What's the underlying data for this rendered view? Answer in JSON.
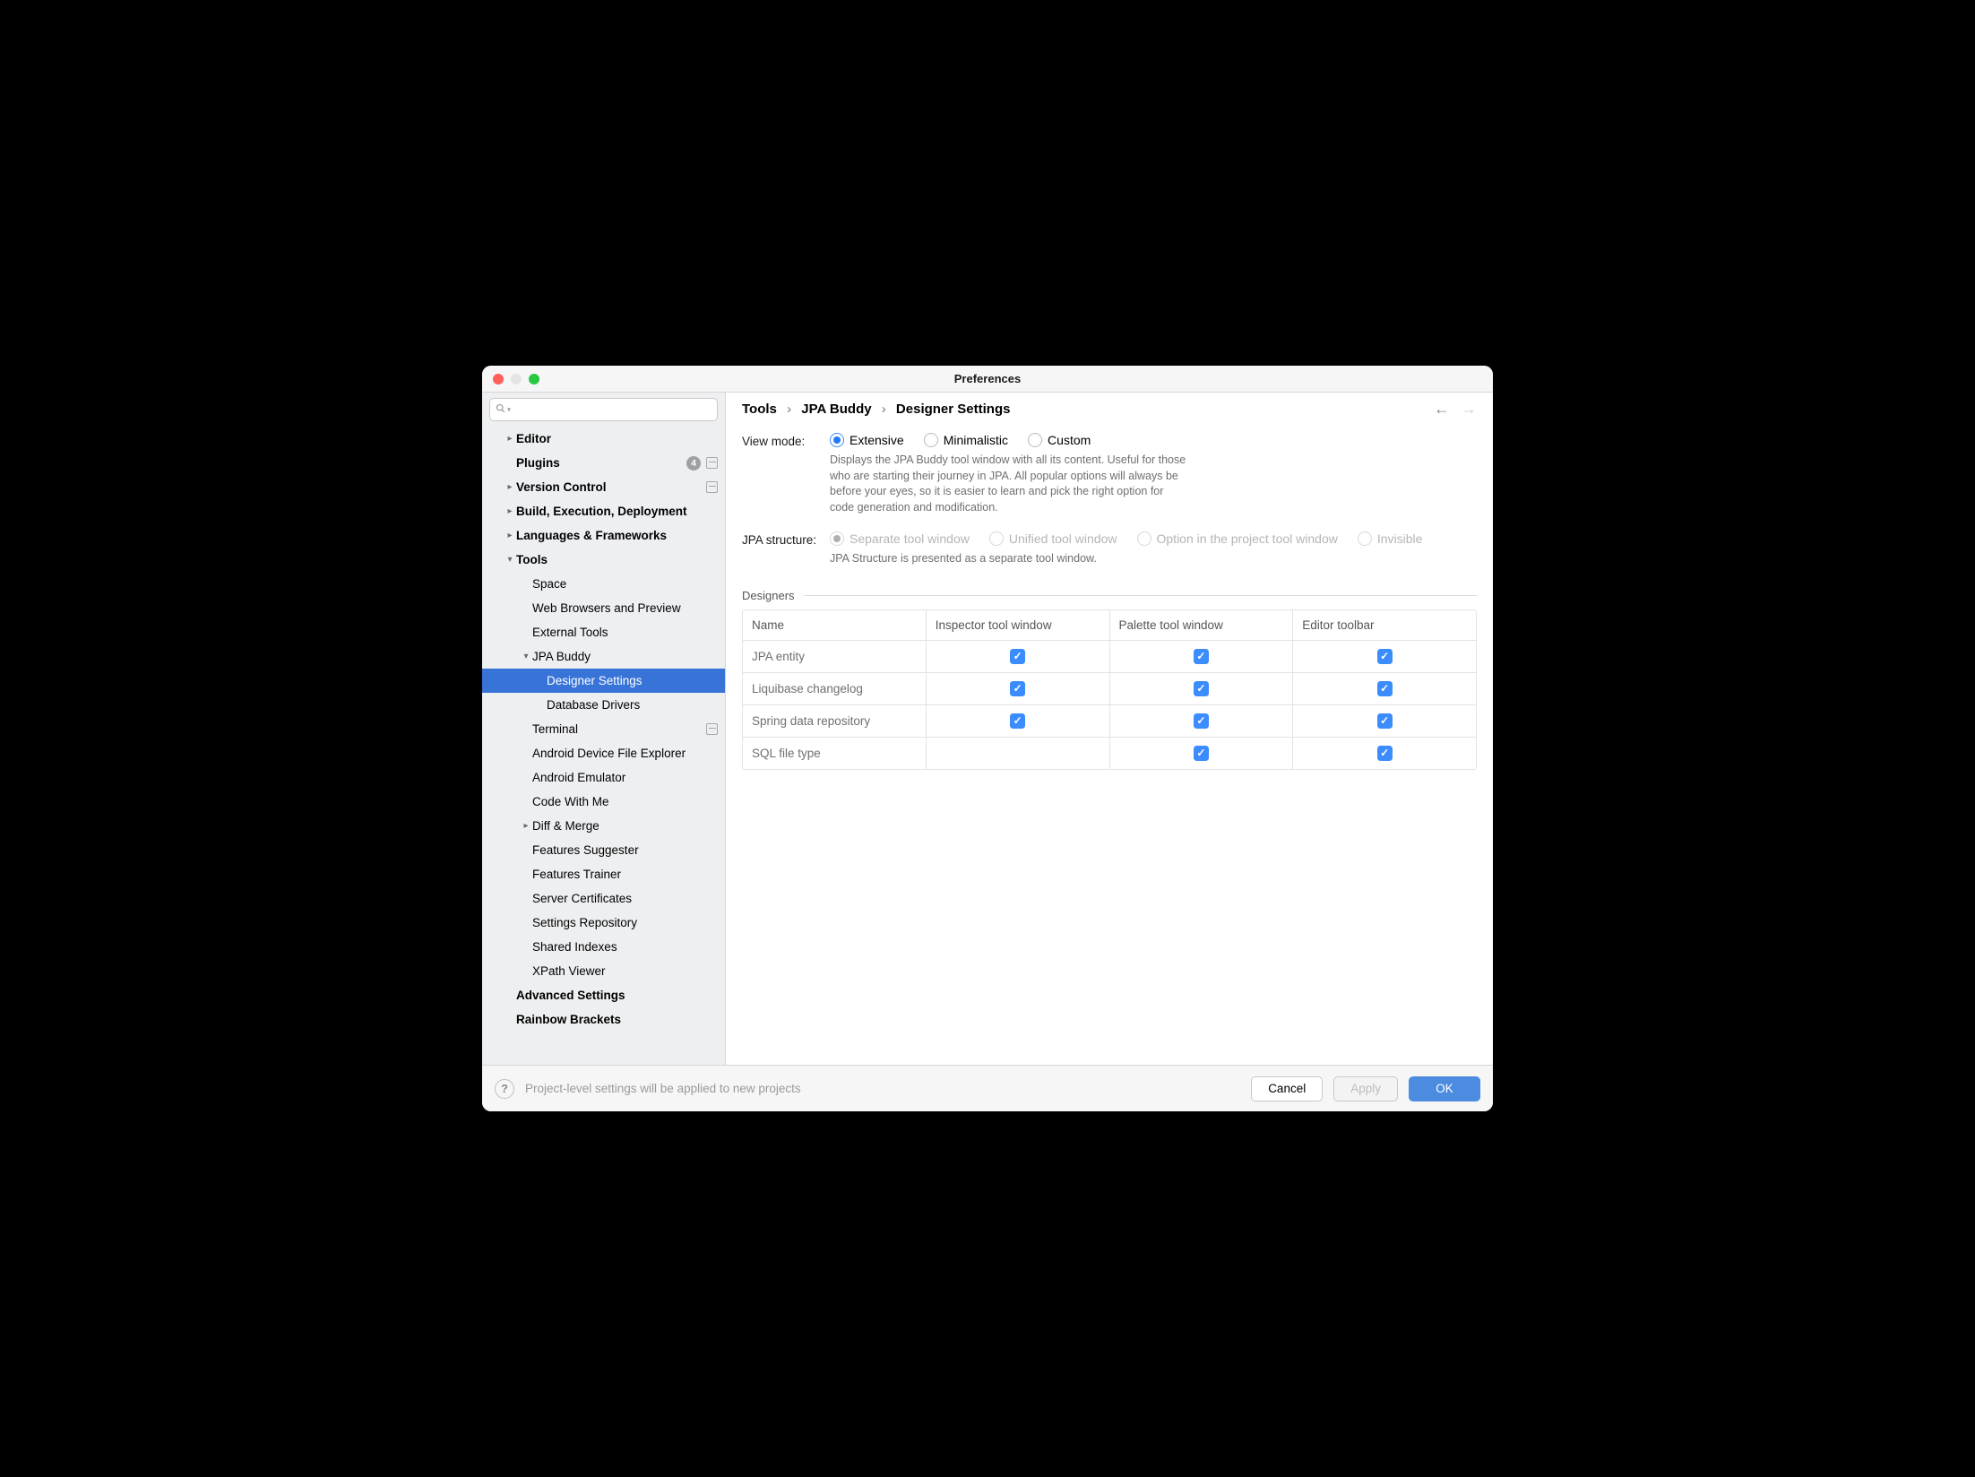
{
  "title": "Preferences",
  "search_placeholder": "",
  "sidebar": {
    "items": [
      {
        "label": "Editor",
        "bold": true,
        "chev": "right",
        "indent": 1,
        "bkm": false
      },
      {
        "label": "Plugins",
        "bold": true,
        "chev": "",
        "indent": 1,
        "badge": "4",
        "bkm": true
      },
      {
        "label": "Version Control",
        "bold": true,
        "chev": "right",
        "indent": 1,
        "bkm": true
      },
      {
        "label": "Build, Execution, Deployment",
        "bold": true,
        "chev": "right",
        "indent": 1,
        "bkm": false
      },
      {
        "label": "Languages & Frameworks",
        "bold": true,
        "chev": "right",
        "indent": 1,
        "bkm": false
      },
      {
        "label": "Tools",
        "bold": true,
        "chev": "down",
        "indent": 1,
        "bkm": false
      },
      {
        "label": "Space",
        "bold": false,
        "chev": "",
        "indent": 2,
        "bkm": false
      },
      {
        "label": "Web Browsers and Preview",
        "bold": false,
        "chev": "",
        "indent": 2,
        "bkm": false
      },
      {
        "label": "External Tools",
        "bold": false,
        "chev": "",
        "indent": 2,
        "bkm": false
      },
      {
        "label": "JPA Buddy",
        "bold": false,
        "chev": "down",
        "indent": 2,
        "bkm": false
      },
      {
        "label": "Designer Settings",
        "bold": false,
        "chev": "",
        "indent": 3,
        "selected": true,
        "bkm": false
      },
      {
        "label": "Database Drivers",
        "bold": false,
        "chev": "",
        "indent": 3,
        "bkm": false
      },
      {
        "label": "Terminal",
        "bold": false,
        "chev": "",
        "indent": 2,
        "bkm": true
      },
      {
        "label": "Android Device File Explorer",
        "bold": false,
        "chev": "",
        "indent": 2,
        "bkm": false
      },
      {
        "label": "Android Emulator",
        "bold": false,
        "chev": "",
        "indent": 2,
        "bkm": false
      },
      {
        "label": "Code With Me",
        "bold": false,
        "chev": "",
        "indent": 2,
        "bkm": false
      },
      {
        "label": "Diff & Merge",
        "bold": false,
        "chev": "right",
        "indent": 2,
        "bkm": false
      },
      {
        "label": "Features Suggester",
        "bold": false,
        "chev": "",
        "indent": 2,
        "bkm": false
      },
      {
        "label": "Features Trainer",
        "bold": false,
        "chev": "",
        "indent": 2,
        "bkm": false
      },
      {
        "label": "Server Certificates",
        "bold": false,
        "chev": "",
        "indent": 2,
        "bkm": false
      },
      {
        "label": "Settings Repository",
        "bold": false,
        "chev": "",
        "indent": 2,
        "bkm": false
      },
      {
        "label": "Shared Indexes",
        "bold": false,
        "chev": "",
        "indent": 2,
        "bkm": false
      },
      {
        "label": "XPath Viewer",
        "bold": false,
        "chev": "",
        "indent": 2,
        "bkm": false
      },
      {
        "label": "Advanced Settings",
        "bold": true,
        "chev": "",
        "indent": 1,
        "bkm": false
      },
      {
        "label": "Rainbow Brackets",
        "bold": true,
        "chev": "",
        "indent": 1,
        "bkm": false
      }
    ]
  },
  "breadcrumb": [
    "Tools",
    "JPA Buddy",
    "Designer Settings"
  ],
  "view_mode": {
    "label": "View mode:",
    "options": [
      "Extensive",
      "Minimalistic",
      "Custom"
    ],
    "selected": "Extensive",
    "helper": "Displays the JPA Buddy tool window with all its content. Useful for those who are starting their journey in JPA. All popular options will always be before your eyes, so it is easier to learn and pick the right option for code generation and modification."
  },
  "jpa_structure": {
    "label": "JPA structure:",
    "options": [
      "Separate tool window",
      "Unified tool window",
      "Option in the project tool window",
      "Invisible"
    ],
    "selected": "Separate tool window",
    "disabled": true,
    "helper": "JPA Structure is presented as a separate tool window."
  },
  "designers": {
    "section": "Designers",
    "headers": [
      "Name",
      "Inspector tool window",
      "Palette tool window",
      "Editor toolbar"
    ],
    "rows": [
      {
        "name": "JPA entity",
        "inspector": true,
        "palette": true,
        "toolbar": true
      },
      {
        "name": "Liquibase changelog",
        "inspector": true,
        "palette": true,
        "toolbar": true
      },
      {
        "name": "Spring data repository",
        "inspector": true,
        "palette": true,
        "toolbar": true
      },
      {
        "name": "SQL file type",
        "inspector": false,
        "palette": true,
        "toolbar": true
      }
    ]
  },
  "footer": {
    "note": "Project-level settings will be applied to new projects",
    "cancel": "Cancel",
    "apply": "Apply",
    "ok": "OK"
  }
}
